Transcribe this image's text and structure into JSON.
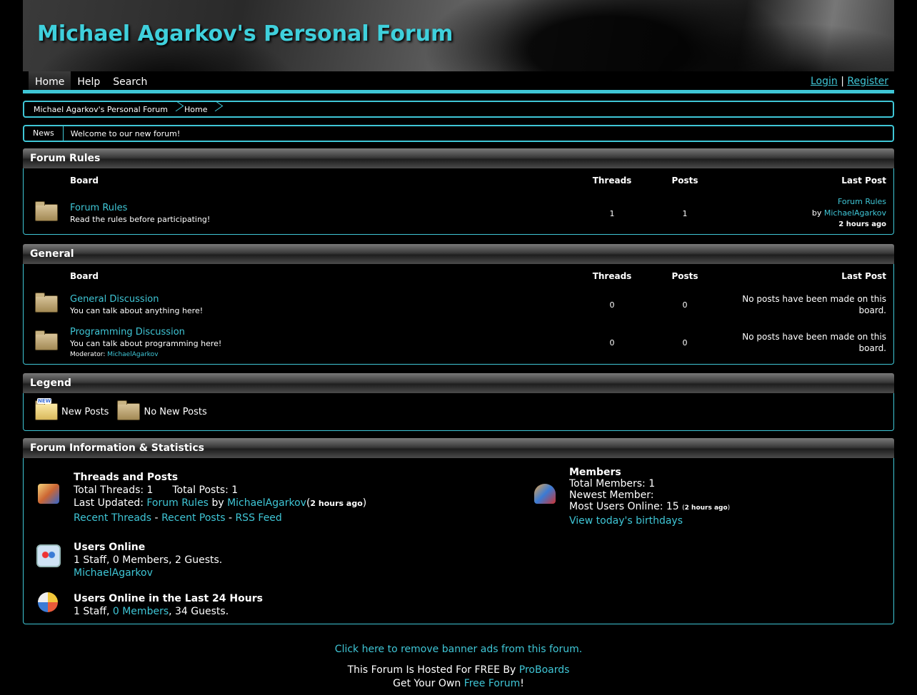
{
  "header": {
    "title": "Michael Agarkov's Personal Forum",
    "nav": [
      "Home",
      "Help",
      "Search"
    ],
    "login": "Login",
    "separator": "|",
    "register": "Register"
  },
  "breadcrumb": [
    "Michael Agarkov's Personal Forum",
    "Home"
  ],
  "news": {
    "label": "News",
    "message": "Welcome to our new forum!"
  },
  "table_headers": {
    "board": "Board",
    "threads": "Threads",
    "posts": "Posts",
    "last_post": "Last Post"
  },
  "categories": [
    {
      "title": "Forum Rules",
      "boards": [
        {
          "name": "Forum Rules",
          "description": "Read the rules before participating!",
          "threads": "1",
          "posts": "1",
          "last_post": {
            "title": "Forum Rules",
            "by": "by",
            "author": "MichaelAgarkov",
            "ago": "2 hours ago"
          }
        }
      ]
    },
    {
      "title": "General",
      "boards": [
        {
          "name": "General Discussion",
          "description": "You can talk about anything here!",
          "threads": "0",
          "posts": "0",
          "last_post_text": "No posts have been made on this board."
        },
        {
          "name": "Programming Discussion",
          "description": "You can talk about programming here!",
          "moderator_label": "Moderator:",
          "moderator": "MichaelAgarkov",
          "threads": "0",
          "posts": "0",
          "last_post_text": "No posts have been made on this board."
        }
      ]
    }
  ],
  "legend": {
    "title": "Legend",
    "new_tag": "NEW",
    "new_posts": "New Posts",
    "no_new_posts": "No New Posts"
  },
  "stats": {
    "title": "Forum Information & Statistics",
    "threads_posts": {
      "heading": "Threads and Posts",
      "total_threads": "Total Threads: 1",
      "total_posts": "Total Posts: 1",
      "last_updated_label": "Last Updated:",
      "last_updated_board": "Forum Rules",
      "by": "by",
      "last_updated_user": "MichaelAgarkov",
      "last_updated_ago": "2 hours ago",
      "recent_threads": "Recent Threads",
      "recent_posts": "Recent Posts",
      "rss": "RSS Feed",
      "dash": "-"
    },
    "members": {
      "heading": "Members",
      "total": "Total Members: 1",
      "newest": "Newest Member:",
      "most_online": "Most Users Online: 15",
      "most_online_ago": "2 hours ago",
      "birthdays": "View today's birthdays"
    },
    "online": {
      "heading": "Users Online",
      "summary": "1 Staff, 0 Members, 2 Guests.",
      "user": "MichaelAgarkov"
    },
    "online24": {
      "heading": "Users Online in the Last 24 Hours",
      "staff": "1 Staff,",
      "members": "0 Members",
      "guests": ", 34 Guests."
    }
  },
  "footer": {
    "remove_ads": "Click here to remove banner ads from this forum.",
    "hosted_prefix": "This Forum Is Hosted For FREE By",
    "hosted_link": "ProBoards",
    "get_prefix": "Get Your Own",
    "get_link": "Free Forum",
    "get_suffix": "!"
  }
}
